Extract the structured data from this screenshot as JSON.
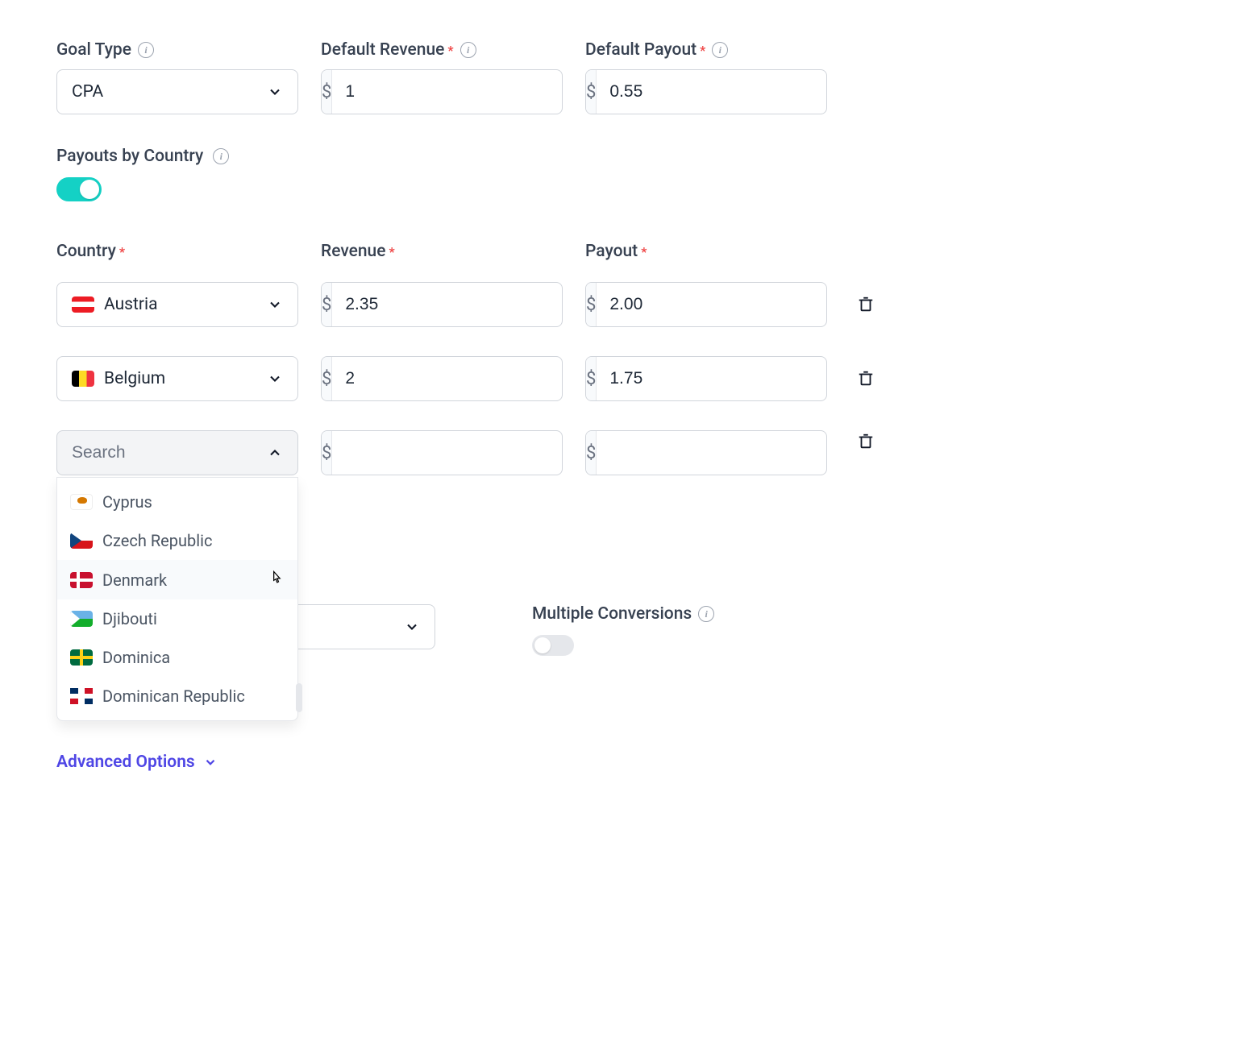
{
  "goal_type": {
    "label": "Goal Type",
    "value": "CPA"
  },
  "default_revenue": {
    "label": "Default Revenue",
    "currency": "$",
    "value": "1"
  },
  "default_payout": {
    "label": "Default Payout",
    "currency": "$",
    "value": "0.55"
  },
  "payouts_by_country": {
    "label": "Payouts by Country",
    "enabled": true
  },
  "columns": {
    "country": "Country",
    "revenue": "Revenue",
    "payout": "Payout"
  },
  "rows": [
    {
      "country": "Austria",
      "flag": "austria",
      "revenue": "2.35",
      "payout": "2.00"
    },
    {
      "country": "Belgium",
      "flag": "belgium",
      "revenue": "2",
      "payout": "1.75"
    }
  ],
  "search": {
    "placeholder": "Search",
    "currency": "$"
  },
  "dropdown_options": [
    {
      "name": "Cyprus",
      "flag": "cyprus"
    },
    {
      "name": "Czech Republic",
      "flag": "czech"
    },
    {
      "name": "Denmark",
      "flag": "denmark",
      "hover": true
    },
    {
      "name": "Djibouti",
      "flag": "djibouti"
    },
    {
      "name": "Dominica",
      "flag": "dominica"
    },
    {
      "name": "Dominican Republic",
      "flag": "dominican"
    }
  ],
  "multiple_conversions": {
    "label": "Multiple Conversions",
    "enabled": false
  },
  "advanced": {
    "label": "Advanced Options"
  }
}
